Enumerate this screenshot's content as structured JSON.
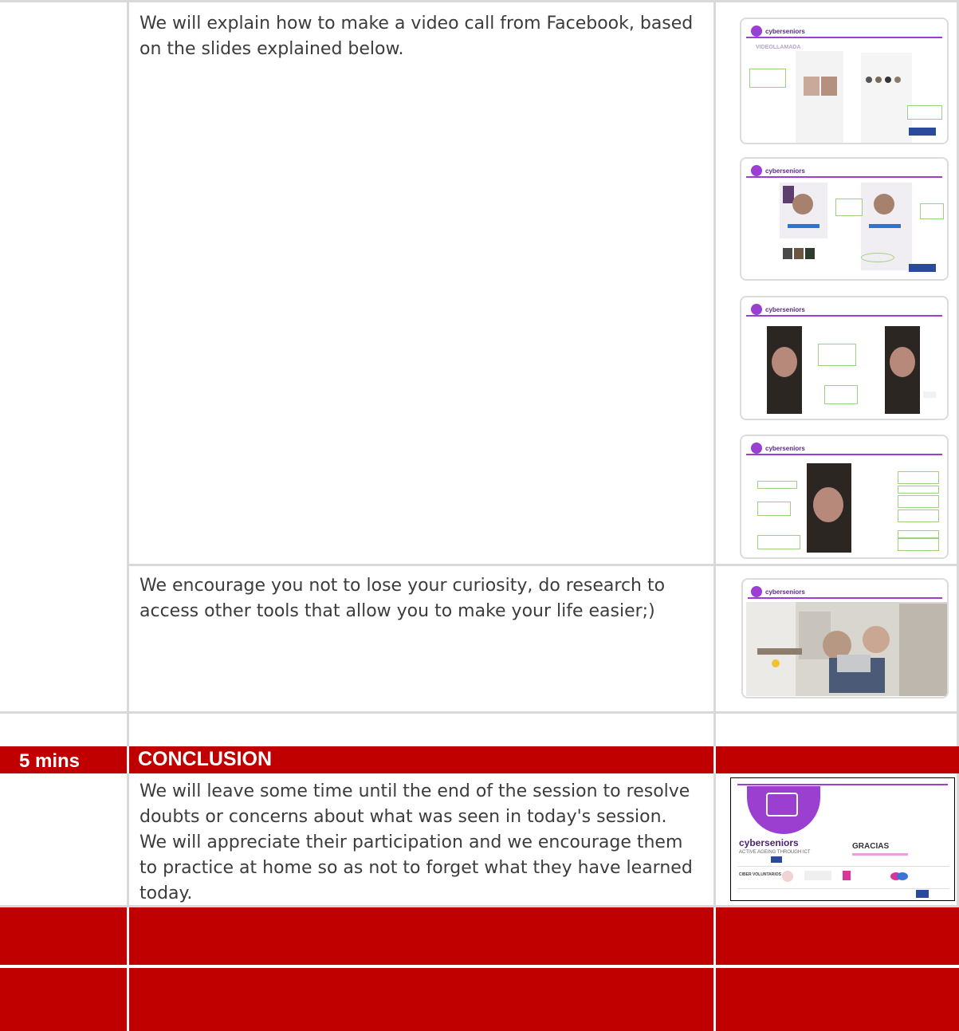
{
  "rows": {
    "videocall": {
      "text": "We will explain how to make a video call from Facebook, based on the slides explained below."
    },
    "curiosity": {
      "text": "We encourage you not to lose your curiosity, do research to access other tools that allow you to make your life easier;)"
    },
    "conclusion_header": {
      "time": "5 mins",
      "title": "CONCLUSION"
    },
    "conclusion": {
      "text": "We will leave some time until the end of the session to resolve doubts or concerns about what was seen in today's session. We will appreciate their participation and we encourage them to practice at home so as not to forget what they have learned today."
    }
  },
  "slides": {
    "logo_text": "cyberseniors",
    "slide1_title": "VIDEOLLAMADA",
    "final_logo": "cyberseniors",
    "final_tagline": "ACTIVE AGEING THROUGH ICT",
    "final_thanks": "GRACIAS",
    "final_partner": "CIBER VOLUNTARIOS"
  },
  "colors": {
    "header_red": "#c00000",
    "accent_purple": "#9b3fd1",
    "border_gray": "#d9d9d9"
  }
}
